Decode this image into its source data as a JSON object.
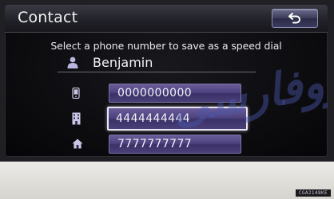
{
  "header": {
    "title": "Contact",
    "back_icon": "back-arrow-icon"
  },
  "instruction": "Select a phone number to save as a speed dial",
  "contact": {
    "name": "Benjamin",
    "icon": "person-icon"
  },
  "numbers": [
    {
      "icon": "mobile-phone-icon",
      "value": "0000000000",
      "selected": false
    },
    {
      "icon": "office-phone-icon",
      "value": "4444444444",
      "selected": true
    },
    {
      "icon": "home-icon",
      "value": "7777777777",
      "selected": false
    }
  ],
  "caption_code": "CGA2148KE",
  "watermark": "دروفارسی",
  "colors": {
    "button_purple": "#4e4380",
    "header_bg": "#22222a",
    "screen_bg": "#0b0b0e",
    "text": "#f0f0f4"
  }
}
